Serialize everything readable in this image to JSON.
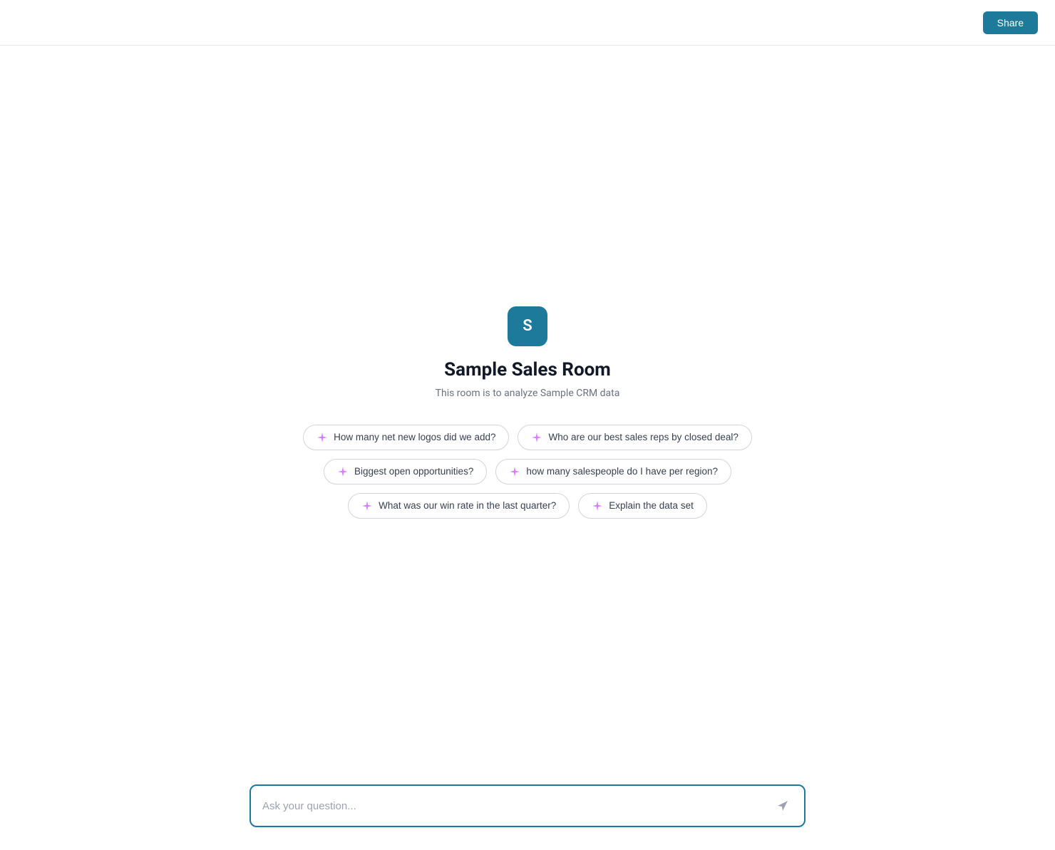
{
  "header": {
    "share_button_label": "Share"
  },
  "app_icon": {
    "letter": "S",
    "bg_color": "#1d7a9b"
  },
  "room": {
    "title": "Sample Sales Room",
    "subtitle": "This room is to analyze Sample CRM data"
  },
  "suggestions": {
    "rows": [
      [
        {
          "id": "s1",
          "text": "How many net new logos did we add?"
        },
        {
          "id": "s2",
          "text": "Who are our best sales reps by closed deal?"
        }
      ],
      [
        {
          "id": "s3",
          "text": "Biggest open opportunities?"
        },
        {
          "id": "s4",
          "text": "how many salespeople do I have per region?"
        }
      ],
      [
        {
          "id": "s5",
          "text": "What was our win rate in the last quarter?"
        },
        {
          "id": "s6",
          "text": "Explain the data set"
        }
      ]
    ]
  },
  "chat_input": {
    "placeholder": "Ask your question..."
  },
  "icons": {
    "sparkle": "✦",
    "send": "➤"
  }
}
